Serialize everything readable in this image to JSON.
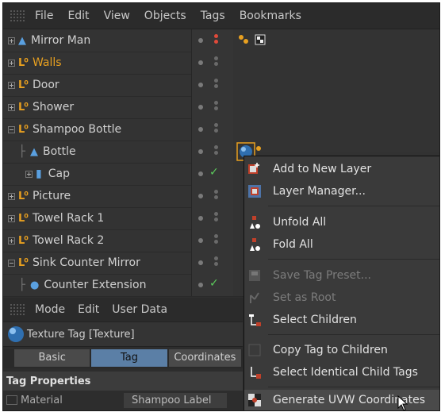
{
  "menubar": {
    "items": [
      "File",
      "Edit",
      "View",
      "Objects",
      "Tags",
      "Bookmarks"
    ]
  },
  "objects": [
    {
      "label": "Mirror Man",
      "color": "#d0d0d0",
      "icon": "figure-icon",
      "indent": 0,
      "expand": "plus"
    },
    {
      "label": "Walls",
      "color": "#e8a020",
      "icon": "null-object-icon",
      "indent": 0,
      "expand": "plus"
    },
    {
      "label": "Door",
      "color": "#d0d0d0",
      "icon": "null-object-icon",
      "indent": 0,
      "expand": "plus"
    },
    {
      "label": "Shower",
      "color": "#d0d0d0",
      "icon": "null-object-icon",
      "indent": 0,
      "expand": "plus"
    },
    {
      "label": "Shampoo Bottle",
      "color": "#d0d0d0",
      "icon": "null-object-icon",
      "indent": 0,
      "expand": "minus"
    },
    {
      "label": "Bottle",
      "color": "#d0d0d0",
      "icon": "lathe-icon",
      "indent": 1,
      "expand": "none"
    },
    {
      "label": "Cap",
      "color": "#d0d0d0",
      "icon": "cylinder-icon",
      "indent": 1,
      "expand": "plus"
    },
    {
      "label": "Picture",
      "color": "#d0d0d0",
      "icon": "null-object-icon",
      "indent": 0,
      "expand": "plus"
    },
    {
      "label": "Towel Rack 1",
      "color": "#d0d0d0",
      "icon": "null-object-icon",
      "indent": 0,
      "expand": "plus"
    },
    {
      "label": "Towel Rack 2",
      "color": "#d0d0d0",
      "icon": "null-object-icon",
      "indent": 0,
      "expand": "plus"
    },
    {
      "label": "Sink Counter Mirror",
      "color": "#d0d0d0",
      "icon": "null-object-icon",
      "indent": 0,
      "expand": "minus"
    },
    {
      "label": "Counter Extension",
      "color": "#d0d0d0",
      "icon": "extrude-icon",
      "indent": 1,
      "expand": "none"
    }
  ],
  "attributes": {
    "menu": [
      "Mode",
      "Edit",
      "User Data"
    ],
    "tag_title": "Texture Tag [Texture]",
    "tabs": [
      "Basic",
      "Tag",
      "Coordinates"
    ],
    "active_tab": "Tag",
    "section": "Tag Properties",
    "material_label": "Material",
    "material_value": "Shampoo Label"
  },
  "context_menu": {
    "items": [
      {
        "label": "Add to New Layer",
        "icon": "layer-add-icon",
        "disabled": false
      },
      {
        "label": "Layer Manager...",
        "icon": "layer-manager-icon",
        "disabled": false
      },
      {
        "label": "Unfold All",
        "icon": "unfold-all-icon",
        "disabled": false
      },
      {
        "label": "Fold All",
        "icon": "fold-all-icon",
        "disabled": false
      },
      {
        "label": "Save Tag Preset...",
        "icon": "save-preset-icon",
        "disabled": true
      },
      {
        "label": "Set as Root",
        "icon": "set-root-icon",
        "disabled": true
      },
      {
        "label": "Select Children",
        "icon": "select-children-icon",
        "disabled": false
      },
      {
        "label": "Copy Tag to Children",
        "icon": "copy-tag-icon",
        "disabled": false
      },
      {
        "label": "Select Identical Child Tags",
        "icon": "select-identical-icon",
        "disabled": false
      },
      {
        "label": "Generate UVW Coordinates",
        "icon": "generate-uvw-icon",
        "disabled": false
      }
    ]
  },
  "colors": {
    "accent_tab": "#5b7fa6",
    "highlight_label": "#e8a020",
    "check_green": "#5ccc5c",
    "dot_red": "#e04a3a"
  }
}
